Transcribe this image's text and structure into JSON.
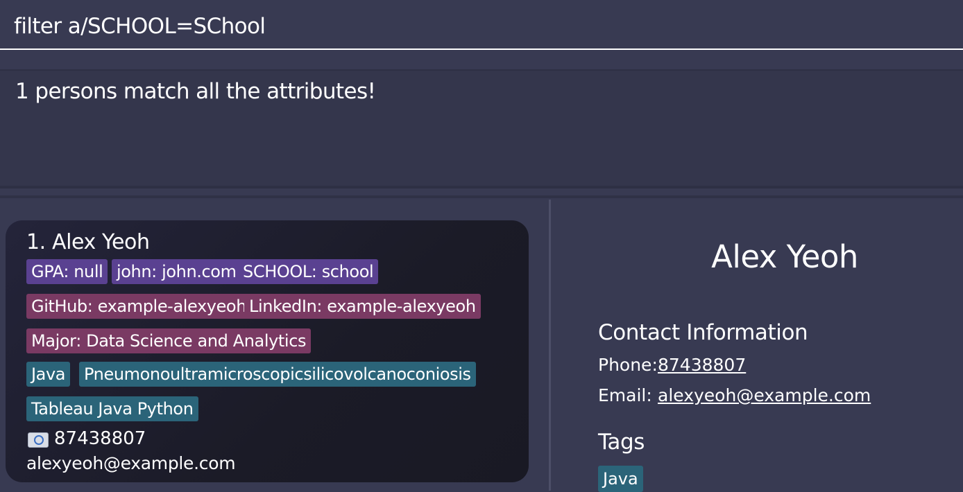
{
  "command_box": {
    "value": "filter a/SCHOOL=SChool"
  },
  "result_display": {
    "message": "1 persons match all the attributes!"
  },
  "person_list": [
    {
      "index_name": "1. Alex Yeoh",
      "attribute_tags": [
        "GPA: null",
        "john: john.com",
        "SCHOOL: school"
      ],
      "link_tags": [
        "GitHub: example-alexyeoh",
        "LinkedIn: example-alexyeoh",
        "Major: Data Science and Analytics"
      ],
      "skill_tags": [
        "Java",
        "Pneumonoultramicroscopicsilicovolcanoconiosis",
        "Tableau Java Python"
      ],
      "phone": "87438807",
      "email": "alexyeoh@example.com",
      "phone_icon": "phone-icon"
    }
  ],
  "detail": {
    "name": "Alex Yeoh",
    "contact_title": "Contact Information",
    "phone_label": "Phone:",
    "phone": "87438807",
    "email_label": "Email:",
    "email": "alexyeoh@example.com",
    "tags_title": "Tags",
    "tags": [
      "Java"
    ]
  },
  "colors": {
    "background": "#383a52",
    "tag_purple": "#5a4191",
    "tag_maroon": "#7a3a63",
    "tag_teal": "#2b6479"
  }
}
